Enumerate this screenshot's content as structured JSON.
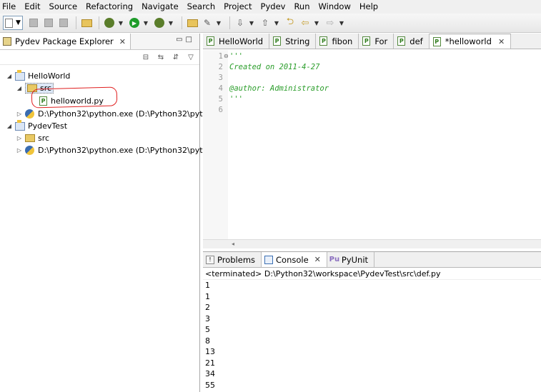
{
  "menu": [
    "File",
    "Edit",
    "Source",
    "Refactoring",
    "Navigate",
    "Search",
    "Project",
    "Pydev",
    "Run",
    "Window",
    "Help"
  ],
  "explorer": {
    "title": "Pydev Package Explorer",
    "tree": [
      {
        "label": "HelloWorld",
        "type": "project",
        "expanded": true,
        "depth": 0
      },
      {
        "label": "src",
        "type": "source-folder",
        "expanded": true,
        "depth": 1
      },
      {
        "label": "helloworld.py",
        "type": "py-file",
        "depth": 2
      },
      {
        "label": "D:\\Python32\\python.exe  (D:\\Python32\\pytho",
        "type": "interpreter",
        "expanded": false,
        "depth": 1
      },
      {
        "label": "PydevTest",
        "type": "project",
        "expanded": true,
        "depth": 0
      },
      {
        "label": "src",
        "type": "source-folder",
        "expanded": false,
        "depth": 1
      },
      {
        "label": "D:\\Python32\\python.exe  (D:\\Python32\\pytho",
        "type": "interpreter",
        "expanded": false,
        "depth": 1
      }
    ]
  },
  "editor": {
    "tabs": [
      {
        "label": "HelloWorld",
        "active": false
      },
      {
        "label": "String",
        "active": false
      },
      {
        "label": "fibon",
        "active": false
      },
      {
        "label": "For",
        "active": false
      },
      {
        "label": "def",
        "active": false
      },
      {
        "label": "*helloworld",
        "active": true
      }
    ],
    "lines": [
      {
        "num": "1",
        "text": "'''"
      },
      {
        "num": "2",
        "text": "Created on 2011-4-27"
      },
      {
        "num": "3",
        "text": ""
      },
      {
        "num": "4",
        "text": "@author: Administrator"
      },
      {
        "num": "5",
        "text": "'''"
      },
      {
        "num": "6",
        "text": ""
      }
    ]
  },
  "console": {
    "tabs": [
      {
        "label": "Problems",
        "active": false
      },
      {
        "label": "Console",
        "active": true
      },
      {
        "label": "PyUnit",
        "active": false
      }
    ],
    "status": "<terminated> D:\\Python32\\workspace\\PydevTest\\src\\def.py",
    "output": [
      "1",
      "1",
      "2",
      "3",
      "5",
      "8",
      "13",
      "21",
      "34",
      "55"
    ]
  },
  "colors": {
    "comment_green": "#2a9d2a",
    "highlight_red": "#e02020"
  }
}
